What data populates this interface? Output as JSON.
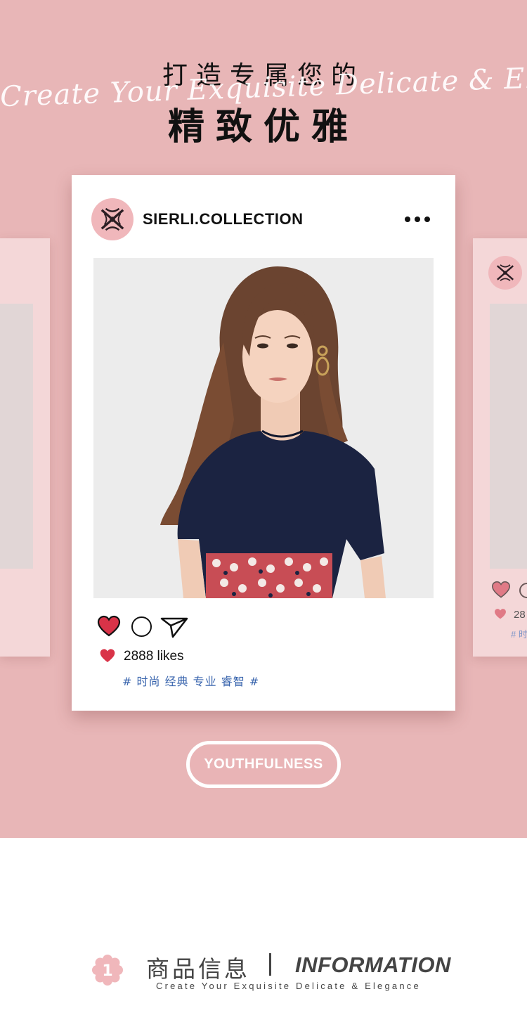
{
  "header": {
    "headline_top": "打造专属您的",
    "script_text": "Create Your Exquisite Delicate & Elegance",
    "headline_main": "精致优雅"
  },
  "post": {
    "username": "SIERLI.COLLECTION",
    "more_icon": "more-dots-icon",
    "photo_desc": "model-photo",
    "like_icon": "heart-icon",
    "comment_icon": "comment-icon",
    "share_icon": "send-icon",
    "likes_text": "2888 likes",
    "tags": "# 时尚 经典 专业 睿智 #"
  },
  "side_card": {
    "likes_partial": "28",
    "tag_partial": "# 时"
  },
  "badge": {
    "label": "YOUTHFULNESS"
  },
  "info": {
    "number": "1",
    "title_cn": "商品信息",
    "title_en": "INFORMATION",
    "subtitle": "Create Your Exquisite Delicate & Elegance"
  },
  "colors": {
    "background_pink": "#e8b6b7",
    "side_card": "#f4d7d8",
    "heart_red": "#d93348",
    "tag_blue": "#3864ad",
    "logo_pink": "#f0b7bb"
  }
}
